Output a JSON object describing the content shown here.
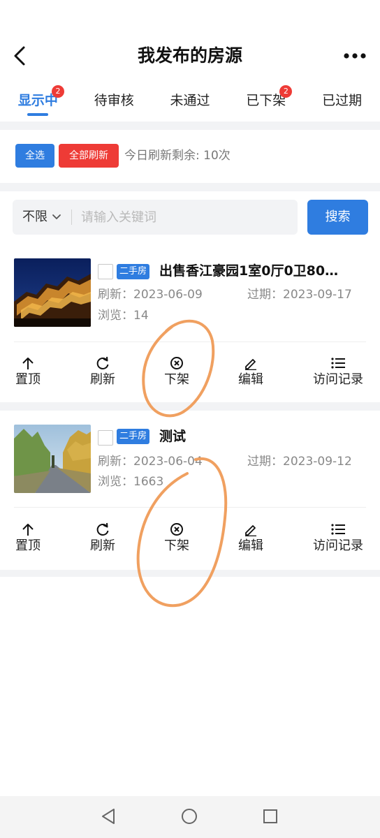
{
  "header": {
    "title": "我发布的房源"
  },
  "tabs": [
    {
      "label": "显示中",
      "badge": "2"
    },
    {
      "label": "待审核"
    },
    {
      "label": "未通过"
    },
    {
      "label": "已下架",
      "badge": "2"
    },
    {
      "label": "已过期"
    }
  ],
  "bulk": {
    "select_all": "全选",
    "refresh_all": "全部刷新",
    "remaining": "今日刷新剩余: 10次"
  },
  "search": {
    "filter": "不限",
    "placeholder": "请输入关键词",
    "button": "搜索"
  },
  "listings": [
    {
      "tag": "二手房",
      "title": "出售香江豪园1室0厅0卫80…",
      "refresh": "刷新：2023-06-09",
      "expire": "过期：2023-09-17",
      "views": "浏览：14"
    },
    {
      "tag": "二手房",
      "title": "测试",
      "refresh": "刷新：2023-06-04",
      "expire": "过期：2023-09-12",
      "views": "浏览：1663"
    }
  ],
  "actions": {
    "top": "置顶",
    "refresh": "刷新",
    "offline": "下架",
    "edit": "编辑",
    "visits": "访问记录"
  },
  "icons": [
    "back-arrow-icon",
    "more-dots-icon",
    "chevron-down-icon",
    "arrow-up-icon",
    "refresh-icon",
    "circle-x-icon",
    "pencil-icon",
    "list-icon",
    "nav-back-icon",
    "nav-home-icon",
    "nav-recent-icon"
  ],
  "colors": {
    "accent": "#2f7de0",
    "danger": "#ee3b36",
    "annotation": "#f0a060"
  }
}
